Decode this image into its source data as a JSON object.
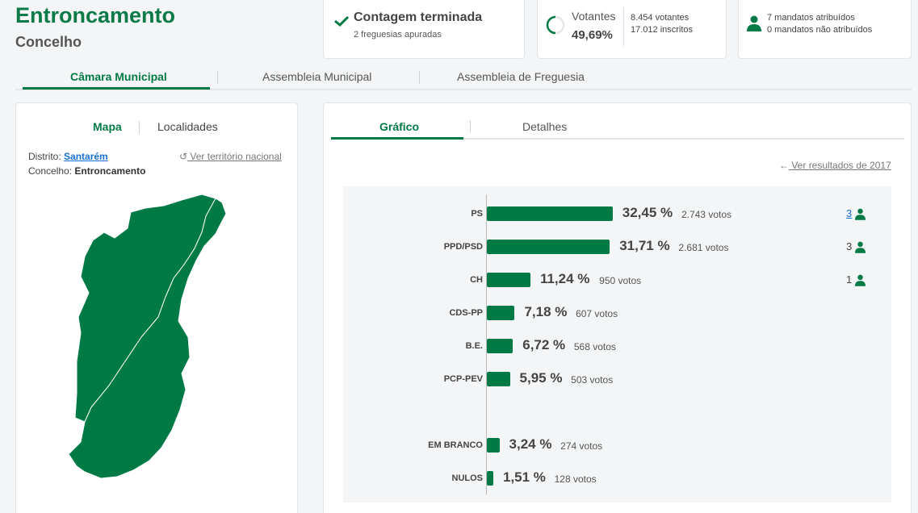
{
  "header": {
    "title": "Entroncamento",
    "subtitle": "Concelho"
  },
  "count_card": {
    "title": "Contagem terminada",
    "sub": "2 freguesias apuradas",
    "icon": "check-icon"
  },
  "voters_card": {
    "label": "Votantes",
    "percent": "49,69%",
    "votantes": "8.454 votantes",
    "inscritos": "17.012 inscritos",
    "turnout_fraction": 0.4969
  },
  "mandates_card": {
    "attributed": "7 mandatos atribuídos",
    "not_attributed": "0 mandatos não atribuídos",
    "icon": "person-icon"
  },
  "main_tabs": [
    {
      "label": "Câmara Municipal"
    },
    {
      "label": "Assembleia Municipal"
    },
    {
      "label": "Assembleia de Freguesia"
    }
  ],
  "left_panel": {
    "tabs": [
      {
        "label": "Mapa"
      },
      {
        "label": "Localidades"
      }
    ],
    "district_label": "Distrito:",
    "district_value": "Santarém",
    "council_label": "Concelho:",
    "council_value": "Entroncamento",
    "national_link": "Ver território nacional"
  },
  "right_panel": {
    "tabs": [
      {
        "label": "Gráfico"
      },
      {
        "label": "Detalhes"
      }
    ],
    "prev_link": "Ver resultados de 2017"
  },
  "colors": {
    "accent": "#007a45",
    "link": "#1a6fd6"
  },
  "chart_data": {
    "type": "bar",
    "orientation": "horizontal",
    "categories": [
      "PS",
      "PPD/PSD",
      "CH",
      "CDS-PP",
      "B.E.",
      "PCP-PEV",
      "EM BRANCO",
      "NULOS"
    ],
    "values": [
      32.45,
      31.71,
      11.24,
      7.18,
      6.72,
      5.95,
      3.24,
      1.51
    ],
    "percent_labels": [
      "32,45 %",
      "31,71 %",
      "11,24 %",
      "7,18 %",
      "6,72 %",
      "5,95 %",
      "3,24 %",
      "1,51 %"
    ],
    "vote_labels": [
      "2.743 votos",
      "2.681 votos",
      "950 votos",
      "607 votos",
      "568 votos",
      "503 votos",
      "274 votos",
      "128 votos"
    ],
    "seats": [
      "3",
      "3",
      "1",
      "",
      "",
      "",
      "",
      ""
    ]
  }
}
